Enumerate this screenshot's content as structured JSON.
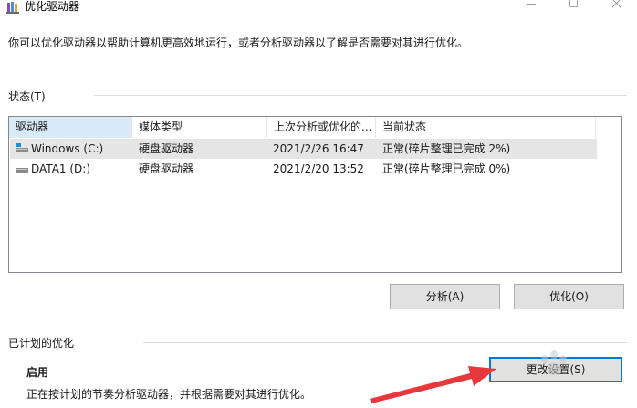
{
  "window": {
    "title": "优化驱动器"
  },
  "description": "你可以优化驱动器以帮助计算机更高效地运行，或者分析驱动器以了解是否需要对其进行优化。",
  "status": {
    "label": "状态(T)",
    "columns": [
      "驱动器",
      "媒体类型",
      "上次分析或优化的...",
      "当前状态"
    ],
    "rows": [
      {
        "drive": "Windows (C:)",
        "media": "硬盘驱动器",
        "last": "2021/2/26 16:47",
        "state": "正常(碎片整理已完成 2%)"
      },
      {
        "drive": "DATA1 (D:)",
        "media": "硬盘驱动器",
        "last": "2021/2/20 13:52",
        "state": "正常(碎片整理已完成 0%)"
      }
    ]
  },
  "buttons": {
    "analyze": "分析(A)",
    "optimize": "优化(O)",
    "change_settings": "更改设置(S)"
  },
  "scheduled": {
    "label": "已计划的优化",
    "status": "启用",
    "description": "正在按计划的节奏分析驱动器，并根据需要对其进行优化。"
  },
  "colors": {
    "accent": "#0078d7",
    "annotation_arrow": "#e8383d",
    "selected_header": "#d9ebf9"
  }
}
